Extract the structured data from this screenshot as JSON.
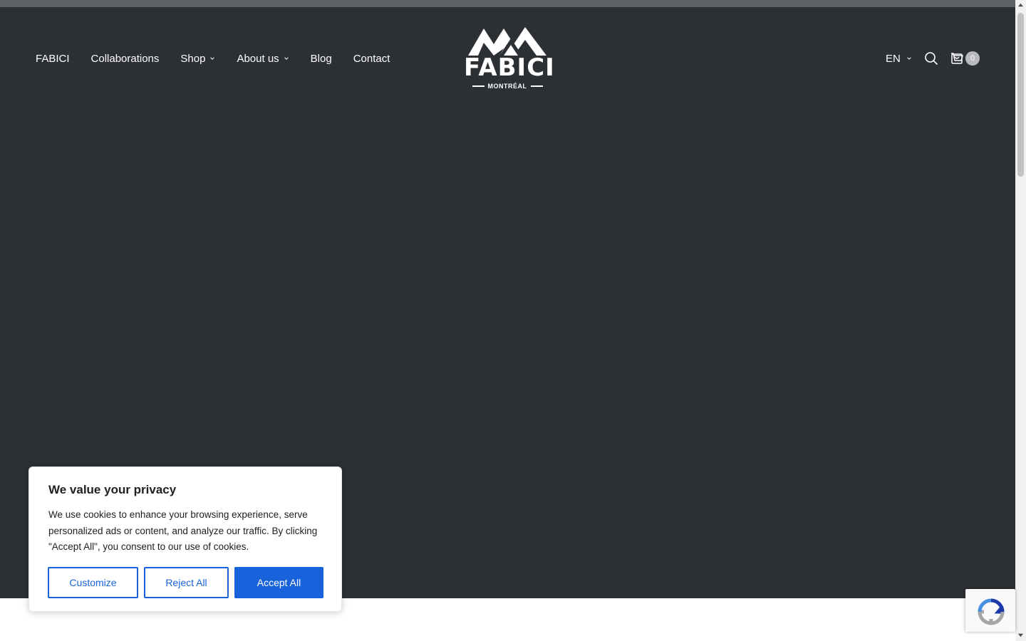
{
  "header": {
    "nav": [
      {
        "label": "FABICI",
        "has_dropdown": false
      },
      {
        "label": "Collaborations",
        "has_dropdown": false
      },
      {
        "label": "Shop",
        "has_dropdown": true
      },
      {
        "label": "About us",
        "has_dropdown": true
      },
      {
        "label": "Blog",
        "has_dropdown": false
      },
      {
        "label": "Contact",
        "has_dropdown": false
      }
    ],
    "logo": {
      "word": "FABICI",
      "sub": "MONTRÉAL"
    },
    "language": "EN",
    "cart_count": "0",
    "icons": [
      "chevron-down-icon",
      "search-icon",
      "cart-icon"
    ]
  },
  "cookie_banner": {
    "title": "We value your privacy",
    "text": "We use cookies to enhance your browsing experience, serve personalized ads or content, and analyze our traffic. By clicking \"Accept All\", you consent to our use of cookies.",
    "customize_label": "Customize",
    "reject_label": "Reject All",
    "accept_label": "Accept All"
  },
  "colors": {
    "hero_bg": "#2c2f33",
    "accent": "#1863dc",
    "badge": "#b8babd"
  }
}
